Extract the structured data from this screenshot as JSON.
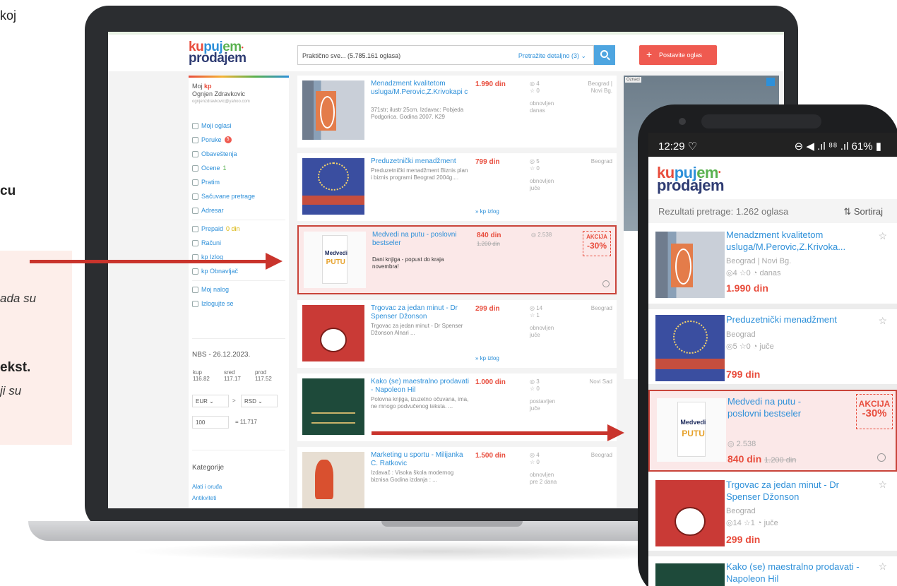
{
  "slide": {
    "frag_top": "koj",
    "frag_cu": "cu",
    "frag_italic1": "ada su",
    "frag_bold": "ekst.",
    "frag_italic2": "ji su"
  },
  "site": {
    "logo_top": [
      "ku",
      "puj",
      "em"
    ],
    "logo_top_mark": "•",
    "logo_bottom": "prodajem",
    "search_placeholder": "Praktično sve... (5.785.161 oglasa)",
    "search_advanced": "Pretražite detaljno (3) ⌄",
    "post_button": "Postavite oglas",
    "post_plus": "+"
  },
  "sidebar": {
    "moj": "Moj",
    "kp": "kp",
    "name": "Ognjen Zdravkovic",
    "email": "ognjenzdravkovic@yahoo.com",
    "items": [
      {
        "label": "Moji oglasi"
      },
      {
        "label": "Poruke",
        "badge": "5"
      },
      {
        "label": "Obaveštenja"
      },
      {
        "label": "Ocene",
        "extra": "1"
      },
      {
        "label": "Pratim"
      },
      {
        "label": "Sačuvane pretrage"
      },
      {
        "label": "Adresar"
      },
      {
        "label": "Prepaid",
        "extra": "0 din"
      },
      {
        "label": "Računi"
      },
      {
        "label": "kp Izlog"
      },
      {
        "label": "kp Obnavljač"
      },
      {
        "label": "Moj nalog"
      },
      {
        "label": "Izlogujte se"
      }
    ],
    "nbs": "NBS - 26.12.2023.",
    "rates_head": [
      "kup",
      "sred",
      "prod"
    ],
    "rates_vals": [
      "116.82",
      "117.17",
      "117.52"
    ],
    "cur_from": "EUR",
    "cur_arrow": ">",
    "cur_to": "RSD",
    "amount": "100",
    "result": "= 11.717",
    "kategorije": "Kategorije",
    "cat_links": [
      "Alati i oruđa",
      "Antikviteti"
    ]
  },
  "listings": [
    {
      "title": "Menadzment kvalitetom usluga/M.Perovic,Z.Krivokapi c",
      "desc": "371str; ilustr 25cm. Izdavac: Pobjeda Podgorica. Godina 2007. K29",
      "price": "1.990 din",
      "views": "4",
      "fav": "0",
      "renew": "obnovljen danas",
      "loc1": "Beograd |",
      "loc2": "Novi Bg."
    },
    {
      "title": "Preduzetnički menadžment",
      "desc": "Preduzetnički menadžment Biznis plan i biznis programi Beograd 2004g....",
      "price": "799 din",
      "views": "5",
      "fav": "0",
      "renew": "obnovljen juče",
      "loc1": "Beograd",
      "loc2": "",
      "kp": "» kp izlog"
    },
    {
      "title": "Medvedi na putu - poslovni bestseler",
      "desc": "Dani knjiga - popust do kraja novembra!",
      "price": "840 din",
      "old": "1.200 din",
      "views": "2.538",
      "akcija": "AKCIJA",
      "pct": "-30%"
    },
    {
      "title": "Trgovac za jedan minut - Dr Spenser Džonson",
      "desc": "Trgovac za jedan minut - Dr Spenser Džonson Alnari ...",
      "price": "299 din",
      "views": "14",
      "fav": "1",
      "renew": "obnovljen juče",
      "loc1": "Beograd",
      "loc2": "",
      "kp": "» kp izlog"
    },
    {
      "title": "Kako (se) maestralno prodavati - Napoleon Hil",
      "desc": "Polovna knjiga, izuzetno očuvana, ima, ne mnogo podvučenog teksta. ...",
      "price": "1.000 din",
      "views": "3",
      "fav": "0",
      "renew": "postavljen juče",
      "loc1": "Novi Sad",
      "loc2": ""
    },
    {
      "title": "Marketing u sportu - Milijanka C. Ratkovic",
      "desc": "Izdavač : Visoka škola modernog biznisa Godina izdanja : ...",
      "price": "1.500 din",
      "views": "4",
      "fav": "0",
      "renew": "obnovljen pre 2 dana",
      "loc1": "Beograd",
      "loc2": ""
    }
  ],
  "ad": {
    "oznaci": "Oznaci"
  },
  "phone": {
    "time": "12:29 ♡",
    "status_right": "⊖ ◀ .ıl ⁸⁸ .ıl 61% ▮",
    "results": "Rezultati pretrage: 1.262 oglasa",
    "sort": "⇅ Sortiraj",
    "items": [
      {
        "title": "Menadzment kvalitetom usluga/M.Perovic,Z.Krivoka...",
        "loc": "Beograd | Novi Bg.",
        "stats": "◎4  ☆0  ◔ danas",
        "price": "1.990 din"
      },
      {
        "title": "Preduzetnički menadžment",
        "loc": "Beograd",
        "stats": "◎5  ☆0  ◔ juče",
        "price": "799 din"
      },
      {
        "title": "Medvedi na putu - poslovni bestseler",
        "stats": "◎ 2.538",
        "price": "840 din",
        "old": "1.200 din",
        "akcija": "AKCIJA",
        "pct": "-30%"
      },
      {
        "title": "Trgovac za jedan minut - Dr Spenser Džonson",
        "loc": "Beograd",
        "stats": "◎14  ☆1  ◔ juče",
        "price": "299 din"
      },
      {
        "title": "Kako (se) maestralno prodavati - Napoleon Hil"
      }
    ]
  },
  "colors": {
    "accent": "#c9342c",
    "link": "#2e90d9",
    "price": "#e84d3d"
  }
}
